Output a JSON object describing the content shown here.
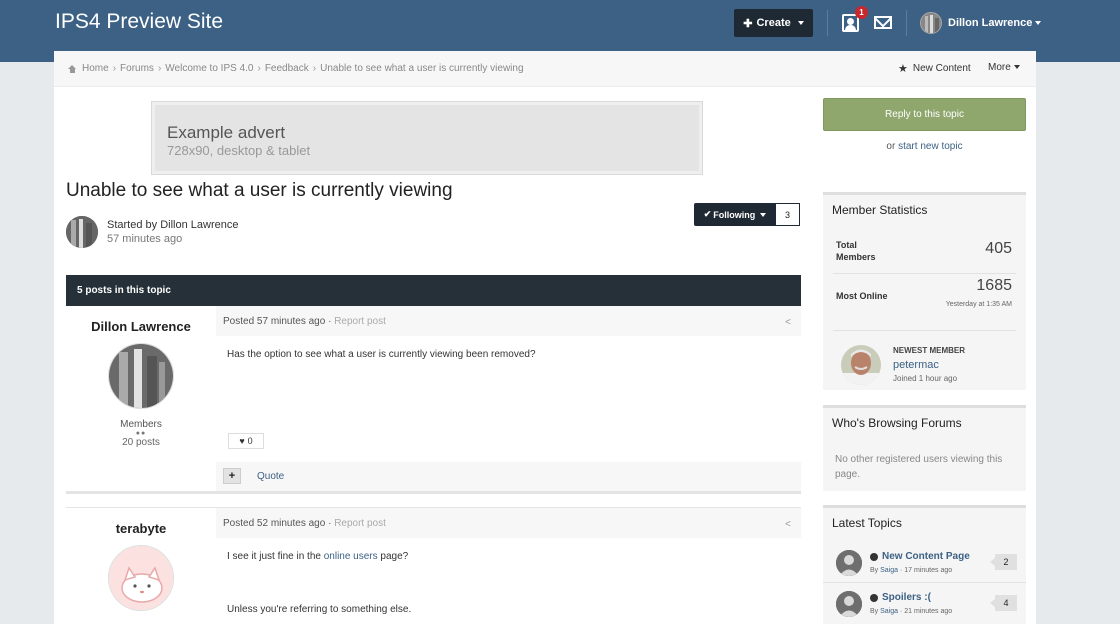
{
  "site": {
    "title": "IPS4 Preview Site"
  },
  "header": {
    "create_label": "Create",
    "notification_count": "1",
    "user_name": "Dillon Lawrence"
  },
  "breadcrumb": {
    "items": [
      "Home",
      "Forums",
      "Welcome to IPS 4.0",
      "Feedback",
      "Unable to see what a user is currently viewing"
    ],
    "new_content": "New Content",
    "more": "More"
  },
  "advert": {
    "title": "Example advert",
    "subtitle": "728x90, desktop & tablet"
  },
  "topic": {
    "title": "Unable to see what a user is currently viewing",
    "started_by": "Started by Dillon Lawrence",
    "started_time": "57 minutes ago",
    "follow_label": "Following",
    "follow_count": "3",
    "posts_bar": "5 posts in this topic"
  },
  "posts": [
    {
      "author": "Dillon Lawrence",
      "group": "Members",
      "post_count": "20 posts",
      "posted": "Posted 57 minutes ago",
      "report": "Report post",
      "content": "Has the option to see what a user is currently viewing been removed?",
      "likes": "0",
      "quote": "Quote"
    },
    {
      "author": "terabyte",
      "posted": "Posted 52 minutes ago",
      "report": "Report post",
      "content_pre": "I see it just fine in the ",
      "content_link": "online users",
      "content_post": " page?",
      "content_2": "Unless you're referring to something else."
    }
  ],
  "sidebar": {
    "reply_label": "Reply to this topic",
    "or_text": "or ",
    "start_new": "start new topic",
    "member_stats": {
      "title": "Member Statistics",
      "total_label_1": "Total",
      "total_label_2": "Members",
      "total_value": "405",
      "online_label": "Most Online",
      "online_value": "1685",
      "online_sub": "Yesterday at 1:35 AM",
      "newest_label": "NEWEST MEMBER",
      "newest_name": "petermac",
      "newest_time": "Joined 1 hour ago"
    },
    "browsing": {
      "title": "Who's Browsing Forums",
      "text": "No other registered users viewing this page."
    },
    "latest": {
      "title": "Latest Topics",
      "items": [
        {
          "name": "New Content Page",
          "by": "By ",
          "author": "Saiga",
          "time": " · 17 minutes ago",
          "count": "2"
        },
        {
          "name": "Spoilers :(",
          "by": "By ",
          "author": "Saiga",
          "time": " · 21 minutes ago",
          "count": "4"
        }
      ]
    }
  },
  "colors": {
    "header": "#3c6185",
    "dark": "#1f2933",
    "reply": "#8fa66d",
    "link": "#3c6185"
  }
}
